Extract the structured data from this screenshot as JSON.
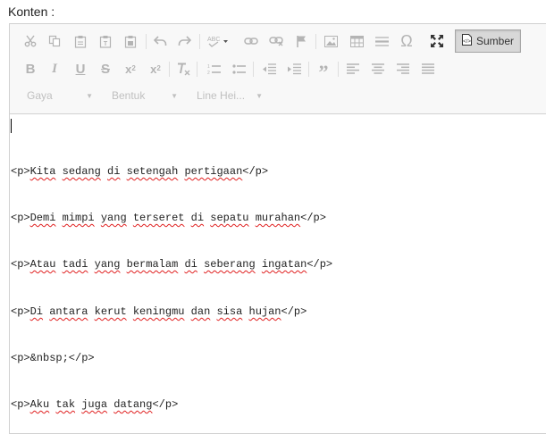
{
  "form": {
    "label": "Konten :"
  },
  "toolbar": {
    "source_label": "Sumber",
    "format_combos": [
      {
        "label": "Gaya"
      },
      {
        "label": "Bentuk"
      },
      {
        "label": "Line Hei..."
      }
    ],
    "icons_row1": [
      "cut-icon",
      "copy-icon",
      "paste-icon",
      "paste-text-icon",
      "paste-word-icon",
      "undo-icon",
      "redo-icon",
      "spellcheck-icon",
      "link-icon",
      "unlink-icon",
      "anchor-icon",
      "image-icon",
      "table-icon",
      "horizontal-rule-icon",
      "special-char-icon",
      "maximize-icon"
    ],
    "icons_row2": [
      "bold-icon",
      "italic-icon",
      "underline-icon",
      "strike-icon",
      "subscript-icon",
      "superscript-icon",
      "remove-format-icon",
      "numbered-list-icon",
      "bulleted-list-icon",
      "outdent-icon",
      "indent-icon",
      "blockquote-icon",
      "align-left-icon",
      "align-center-icon",
      "align-right-icon",
      "justify-icon"
    ]
  },
  "source_lines": [
    {
      "pre": "<p>",
      "words": [
        "Kita",
        "sedang",
        "di",
        "setengah",
        "pertigaan"
      ],
      "post": "</p>"
    },
    {
      "pre": "<p>",
      "words": [
        "Demi",
        "mimpi",
        "yang",
        "terseret",
        "di",
        "sepatu",
        "murahan"
      ],
      "post": "</p>"
    },
    {
      "pre": "<p>",
      "words": [
        "Atau",
        "tadi",
        "yang",
        "bermalam",
        "di",
        "seberang",
        "ingatan"
      ],
      "post": "</p>"
    },
    {
      "pre": "<p>",
      "words": [
        "Di",
        "antara",
        "kerut",
        "keningmu",
        "dan",
        "sisa",
        "hujan"
      ],
      "post": "</p>"
    },
    {
      "pre": "<p>&nbsp;</p>",
      "words": [],
      "post": ""
    },
    {
      "pre": "<p>",
      "words": [
        "Aku",
        "tak",
        "juga",
        "datang"
      ],
      "post": "</p>"
    }
  ]
}
